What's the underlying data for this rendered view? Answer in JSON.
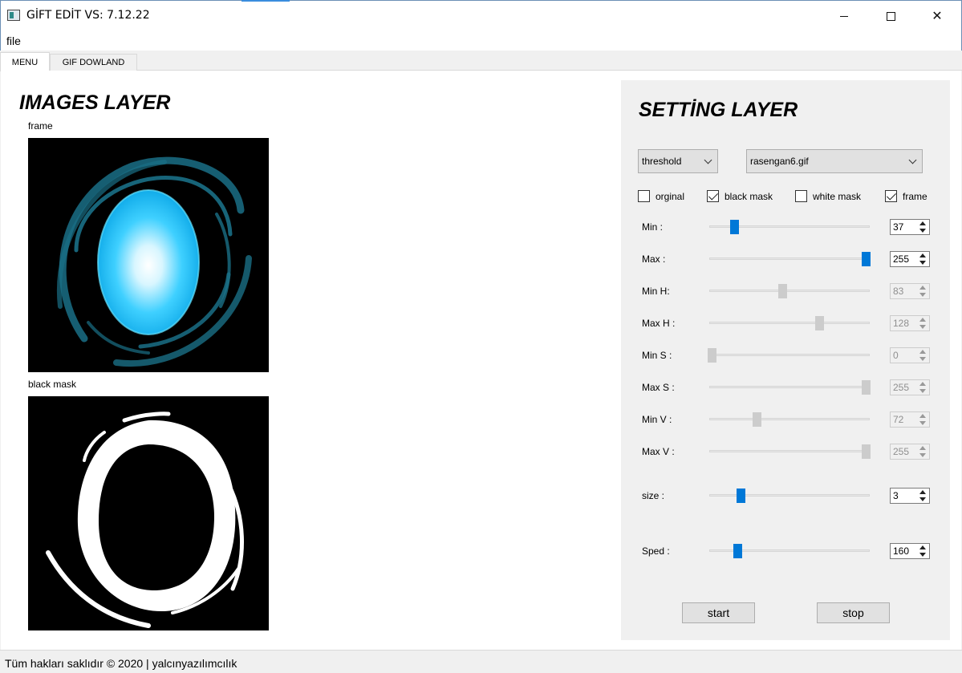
{
  "window": {
    "title": "GİFT EDİT  VS: 7.12.22",
    "minimize": "—",
    "maximize": "☐",
    "close": "✕"
  },
  "menu": {
    "file": "file"
  },
  "tabs": [
    {
      "label": "MENU",
      "active": true
    },
    {
      "label": "GIF DOWLAND",
      "active": false
    }
  ],
  "images": {
    "title": "IMAGES LAYER",
    "frame_label": "frame",
    "mask_label": "black mask"
  },
  "settings": {
    "title": "SETTİNG LAYER",
    "mode_combo": "threshold",
    "file_combo": "rasengan6.gif",
    "checkboxes": [
      {
        "label": "orginal",
        "checked": false
      },
      {
        "label": "black mask",
        "checked": true
      },
      {
        "label": "white mask",
        "checked": false
      },
      {
        "label": "frame",
        "checked": true
      }
    ],
    "rows": [
      {
        "label": "Min :",
        "value": "37",
        "fraction": 0.16,
        "enabled": true
      },
      {
        "label": "Max :",
        "value": "255",
        "fraction": 0.98,
        "enabled": true
      },
      {
        "label": "Min H:",
        "value": "83",
        "fraction": 0.46,
        "enabled": false
      },
      {
        "label": "Max H :",
        "value": "128",
        "fraction": 0.69,
        "enabled": false
      },
      {
        "label": "Min S :",
        "value": "0",
        "fraction": 0.02,
        "enabled": false
      },
      {
        "label": "Max S :",
        "value": "255",
        "fraction": 0.98,
        "enabled": false
      },
      {
        "label": "Min V :",
        "value": "72",
        "fraction": 0.3,
        "enabled": false
      },
      {
        "label": "Max V :",
        "value": "255",
        "fraction": 0.98,
        "enabled": false
      },
      {
        "label": "size :",
        "value": "3",
        "fraction": 0.2,
        "enabled": true
      },
      {
        "label": "Sped :",
        "value": "160",
        "fraction": 0.18,
        "enabled": true
      }
    ],
    "start": "start",
    "stop": "stop"
  },
  "status": {
    "text": "Tüm hakları saklıdır © 2020 | yalcınyazılımcılık"
  }
}
